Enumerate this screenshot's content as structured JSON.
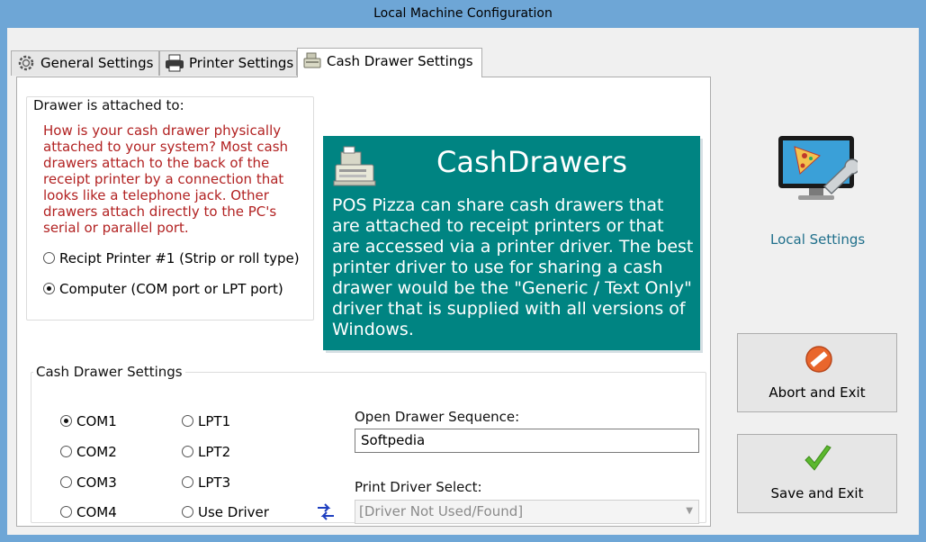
{
  "window": {
    "title": "Local Machine Configuration"
  },
  "tabs": [
    {
      "label": "General Settings",
      "icon": "gear-icon"
    },
    {
      "label": "Printer Settings",
      "icon": "printer-icon"
    },
    {
      "label": "Cash Drawer Settings",
      "icon": "cash-register-icon",
      "active": true
    }
  ],
  "attached": {
    "title": "Drawer is attached to:",
    "help": "How is your cash drawer physically attached to your system?  Most cash drawers attach to the back of the receipt printer by a connection that looks like a telephone jack.  Other drawers attach directly to the PC's serial or parallel port.",
    "options": [
      {
        "label": "Recipt Printer #1 (Strip or roll type)",
        "checked": false
      },
      {
        "label": "Computer (COM port or LPT port)",
        "checked": true
      }
    ]
  },
  "info": {
    "heading": "CashDrawers",
    "body": "POS Pizza can share cash drawers that are attached to receipt printers or that are accessed via a printer driver.  The best printer driver to use for sharing a cash drawer would be the \"Generic / Text Only\" driver that is supplied with all versions of Windows."
  },
  "settings": {
    "title": "Cash Drawer Settings",
    "ports": [
      {
        "label": "COM1",
        "checked": true
      },
      {
        "label": "COM2",
        "checked": false
      },
      {
        "label": "COM3",
        "checked": false
      },
      {
        "label": "COM4",
        "checked": false
      },
      {
        "label": "LPT1",
        "checked": false
      },
      {
        "label": "LPT2",
        "checked": false
      },
      {
        "label": "LPT3",
        "checked": false
      },
      {
        "label": "Use Driver",
        "checked": false
      }
    ],
    "sequence_label": "Open Drawer Sequence:",
    "sequence_value": "Softpedia",
    "driver_label": "Print Driver Select:",
    "driver_value": "[Driver Not Used/Found]"
  },
  "sidebar": {
    "local_settings_label": "Local Settings"
  },
  "buttons": {
    "abort": "Abort and Exit",
    "save": "Save and Exit"
  },
  "colors": {
    "info_bg": "#008482",
    "help_text": "#b22222",
    "link": "#1f6f8b",
    "title_bar": "#6ea6d6"
  }
}
